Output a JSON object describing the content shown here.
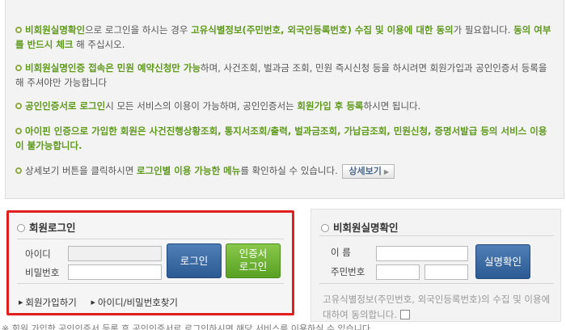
{
  "notice": {
    "item1": {
      "p1": "비회원실명확인",
      "p2": "으로 로그인을 하시는 경우 ",
      "p3": "고유식별정보(주민번호, 외국인등록번호) 수집 및 이용에 대한 동의",
      "p4": "가 필요합니다. ",
      "p5": "동의 여부를 반드시 체크",
      "p6": " 해 주십시오."
    },
    "item2": {
      "p1": "비회원실명인증 접속은 민원 예약신청만 가능",
      "p2": "하며, 사건조회, 벌과금 조회, 민원 즉시신청 등을 하시려면 회원가입과 공인인증서 등록을 해 주셔야만 가능합니다"
    },
    "item3": {
      "p1": "공인인증서로 로그인",
      "p2": "시 모든 서비스의 이용이 가능하며, 공인인증서는 ",
      "p3": "회원가입 후 등록",
      "p4": "하시면 됩니다."
    },
    "item4": {
      "p1": "아이핀 인증으로 가입한 회원은 사건진행상황조회, 통지서조회/출력, 벌과금조회, 가납금조회, 민원신청, 증명서발급 등의 서비스 이용이 불가능합니다."
    },
    "item5": {
      "p1": "상세보기 버튼을 클릭하시면 ",
      "p2": "로그인별 이용 가능한 메뉴",
      "p3": "를 확인하실 수 있습니다.",
      "button": "상세보기"
    }
  },
  "member_login": {
    "title": "회원로그인",
    "id_label": "아이디",
    "pw_label": "비밀번호",
    "id_value": "",
    "pw_value": "",
    "login_button": "로그인",
    "cert_button_line1": "인증서",
    "cert_button_line2": "로그인",
    "join_link": "회원가입하기",
    "find_link": "아이디/비밀번호찾기"
  },
  "guest_verify": {
    "title": "비회원실명확인",
    "name_label": "이 름",
    "rrn_label": "주민번호",
    "name_value": "",
    "rrn_front": "",
    "rrn_back": "",
    "verify_button": "실명확인",
    "consent_text": "고유식별정보(주민번호, 외국인등록번호)의 수집 및 이용에 대하여 동의합니다."
  },
  "footer_note": "※ 회원 가입한 공인인증서 등록 후 공인인증서로 로그인하시면 해당 서비스를 이용하실 수 있습니다."
}
